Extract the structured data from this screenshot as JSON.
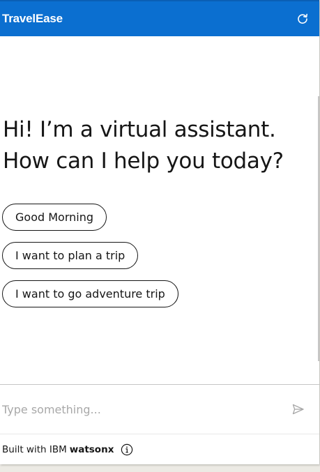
{
  "header": {
    "title": "TravelEase",
    "restart_icon": "restart-icon"
  },
  "greeting": {
    "line1": "Hi! I’m a virtual assistant.",
    "line2": "How can I help you today?"
  },
  "options": [
    {
      "label": "Good Morning"
    },
    {
      "label": "I want to plan a trip"
    },
    {
      "label": "I want to go adventure trip"
    }
  ],
  "input": {
    "placeholder": "Type something...",
    "value": "",
    "send_icon": "send-icon"
  },
  "footer": {
    "prefix": "Built with IBM",
    "brand": "watsonx",
    "info_icon": "info-icon"
  },
  "colors": {
    "header_bg": "#0b6fd0",
    "text": "#161616",
    "placeholder": "#a8a8a8"
  }
}
